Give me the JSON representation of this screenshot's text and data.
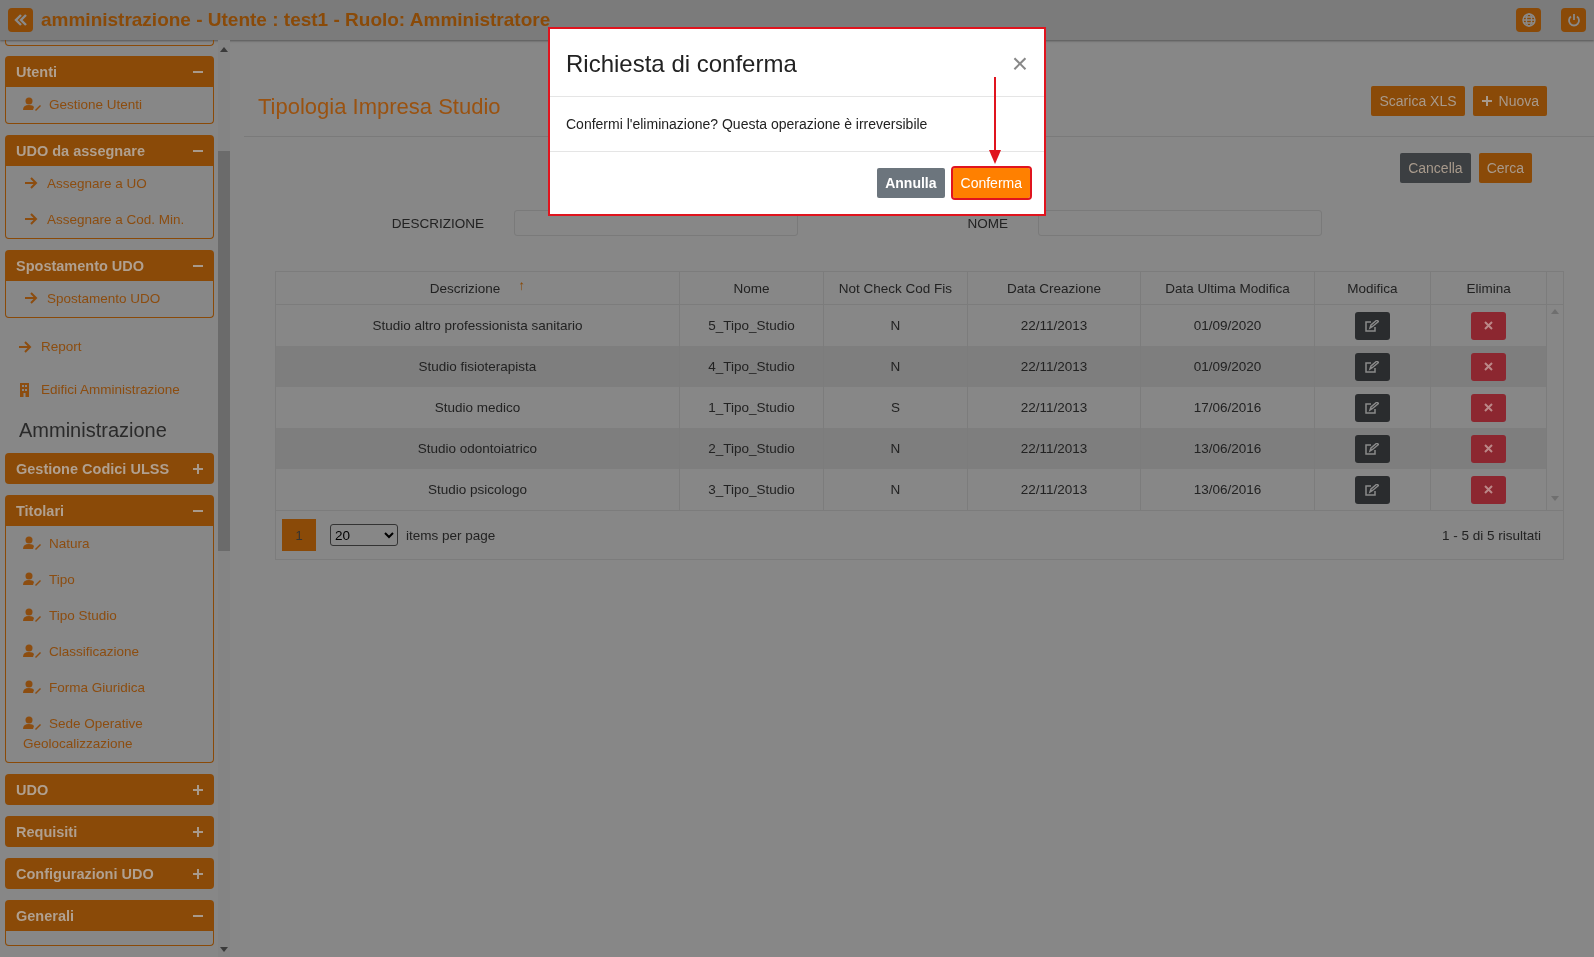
{
  "header": {
    "title": "amministrazione - Utente : test1 - Ruolo: Amministratore"
  },
  "sidebar": [
    {
      "kind": "panel",
      "title": "Utenti",
      "expanded": true,
      "items": [
        {
          "kind": "user",
          "label": "Gestione Utenti"
        }
      ]
    },
    {
      "kind": "panel",
      "title": "UDO da assegnare",
      "expanded": true,
      "items": [
        {
          "kind": "arrow",
          "label": "Assegnare a UO"
        },
        {
          "kind": "arrow",
          "label": "Assegnare a Cod. Min."
        }
      ]
    },
    {
      "kind": "panel",
      "title": "Spostamento UDO",
      "expanded": true,
      "items": [
        {
          "kind": "arrow",
          "label": "Spostamento UDO"
        }
      ]
    },
    {
      "kind": "arrow-link",
      "label": "Report"
    },
    {
      "kind": "building-link",
      "label": "Edifici Amministrazione"
    },
    {
      "kind": "heading",
      "label": "Amministrazione"
    },
    {
      "kind": "panel",
      "title": "Gestione Codici ULSS",
      "expanded": false
    },
    {
      "kind": "panel",
      "title": "Titolari",
      "expanded": true,
      "items": [
        {
          "kind": "user",
          "label": "Natura"
        },
        {
          "kind": "user",
          "label": "Tipo"
        },
        {
          "kind": "user",
          "label": "Tipo Studio"
        },
        {
          "kind": "user",
          "label": "Classificazione"
        },
        {
          "kind": "user",
          "label": "Forma Giuridica"
        },
        {
          "kind": "user",
          "label": "Sede Operative Geolocalizzazione"
        }
      ]
    },
    {
      "kind": "panel",
      "title": "UDO",
      "expanded": false
    },
    {
      "kind": "panel",
      "title": "Requisiti",
      "expanded": false
    },
    {
      "kind": "panel",
      "title": "Configurazioni UDO",
      "expanded": false
    },
    {
      "kind": "panel",
      "title": "Generali",
      "expanded": true
    }
  ],
  "page_title": "Tipologia Impresa Studio",
  "actions": [
    {
      "kind": "plain",
      "label": "Scarica XLS"
    },
    {
      "kind": "add",
      "label": "Nuova"
    }
  ],
  "filter_buttons": [
    {
      "kind": "dark",
      "label": "Cancella"
    },
    {
      "kind": "orange",
      "label": "Cerca"
    }
  ],
  "filters": [
    {
      "label": "DESCRIZIONE"
    },
    {
      "label": "NOME"
    }
  ],
  "table": {
    "columns": [
      {
        "label": "Descrizione",
        "sorted": true
      },
      {
        "label": "Nome",
        "sorted": false
      },
      {
        "label": "Not Check Cod Fis",
        "sorted": false
      },
      {
        "label": "Data Creazione",
        "sorted": false
      },
      {
        "label": "Data Ultima Modifica",
        "sorted": false
      },
      {
        "label": "Modifica",
        "sorted": false
      },
      {
        "label": "Elimina",
        "sorted": false
      }
    ],
    "sort_icon": "↑",
    "rows": [
      [
        "Studio altro professionista sanitario",
        "5_Tipo_Studio",
        "N",
        "22/11/2013",
        "01/09/2020"
      ],
      [
        "Studio fisioterapista",
        "4_Tipo_Studio",
        "N",
        "22/11/2013",
        "01/09/2020"
      ],
      [
        "Studio medico",
        "1_Tipo_Studio",
        "S",
        "22/11/2013",
        "17/06/2016"
      ],
      [
        "Studio odontoiatrico",
        "2_Tipo_Studio",
        "N",
        "22/11/2013",
        "13/06/2016"
      ],
      [
        "Studio psicologo",
        "3_Tipo_Studio",
        "N",
        "22/11/2013",
        "13/06/2016"
      ]
    ]
  },
  "pagination": {
    "pages": [
      {
        "label": "1",
        "selected": true
      }
    ],
    "page_size": "20",
    "per_page_label": "items per page",
    "summary": "1 - 5 di 5 risultati"
  },
  "modal": {
    "title": "Richiesta di conferma",
    "close": "×",
    "message": "Confermi l'eliminazione? Questa operazione è irreversibile",
    "buttons": [
      {
        "kind": "secondary",
        "label": "Annulla",
        "highlighted": false
      },
      {
        "kind": "primary",
        "label": "Conferma",
        "highlighted": true
      }
    ]
  }
}
